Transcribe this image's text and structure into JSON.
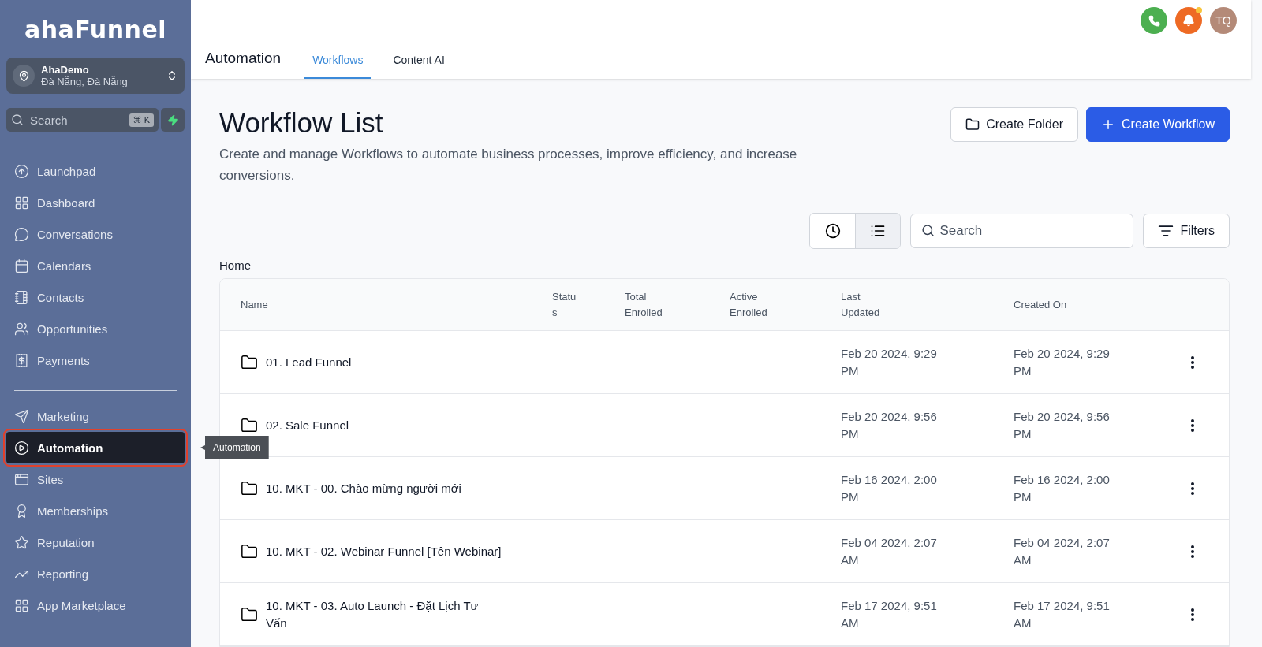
{
  "brand": {
    "logo": "ahaFunnel"
  },
  "account": {
    "name": "AhaDemo",
    "location": "Đà Nẵng, Đà Nẵng"
  },
  "sidebar_search": {
    "placeholder": "Search",
    "shortcut": "⌘ K"
  },
  "nav_groups": [
    [
      {
        "label": "Launchpad",
        "selected": false
      },
      {
        "label": "Dashboard",
        "selected": false
      },
      {
        "label": "Conversations",
        "selected": false
      },
      {
        "label": "Calendars",
        "selected": false
      },
      {
        "label": "Contacts",
        "selected": false
      },
      {
        "label": "Opportunities",
        "selected": false
      },
      {
        "label": "Payments",
        "selected": false
      }
    ],
    [
      {
        "label": "Marketing",
        "selected": false
      },
      {
        "label": "Automation",
        "selected": true,
        "tooltip": "Automation"
      },
      {
        "label": "Sites",
        "selected": false
      },
      {
        "label": "Memberships",
        "selected": false
      },
      {
        "label": "Reputation",
        "selected": false
      },
      {
        "label": "Reporting",
        "selected": false
      },
      {
        "label": "App Marketplace",
        "selected": false
      }
    ]
  ],
  "header": {
    "title": "Automation",
    "tabs": [
      {
        "label": "Workflows",
        "selected": true
      },
      {
        "label": "Content AI",
        "selected": false
      }
    ],
    "avatar": "TQ",
    "notification_dot": true
  },
  "page": {
    "title": "Workflow List",
    "description": "Create and manage Workflows to automate business processes, improve efficiency, and increase conversions.",
    "buttons": [
      {
        "label": "Create Folder",
        "kind": "secondary"
      },
      {
        "label": "Create Workflow",
        "kind": "primary"
      }
    ]
  },
  "toolbar": {
    "views": [
      {
        "kind": "recent",
        "selected": false
      },
      {
        "kind": "list",
        "selected": true
      }
    ],
    "search_placeholder": "Search",
    "filters": "Filters"
  },
  "breadcrumb": "Home",
  "table": {
    "columns": [
      "Name",
      "Status",
      "Total Enrolled",
      "Active Enrolled",
      "Last Updated",
      "Created On"
    ],
    "rows": [
      {
        "name": "01. Lead Funnel",
        "last_updated": "Feb 20 2024, 9:29 PM",
        "created_on": "Feb 20 2024, 9:29 PM"
      },
      {
        "name": "02. Sale Funnel",
        "last_updated": "Feb 20 2024, 9:56 PM",
        "created_on": "Feb 20 2024, 9:56 PM"
      },
      {
        "name": "10. MKT - 00. Chào mừng người mới",
        "last_updated": "Feb 16 2024, 2:00 PM",
        "created_on": "Feb 16 2024, 2:00 PM"
      },
      {
        "name": "10. MKT - 02. Webinar Funnel [Tên Webinar]",
        "last_updated": "Feb 04 2024, 2:07 AM",
        "created_on": "Feb 04 2024, 2:07 AM"
      },
      {
        "name": "10. MKT - 03. Auto Launch - Đặt Lịch Tư Vấn",
        "last_updated": "Feb 17 2024, 9:51 AM",
        "created_on": "Feb 17 2024, 9:51 AM"
      }
    ]
  }
}
